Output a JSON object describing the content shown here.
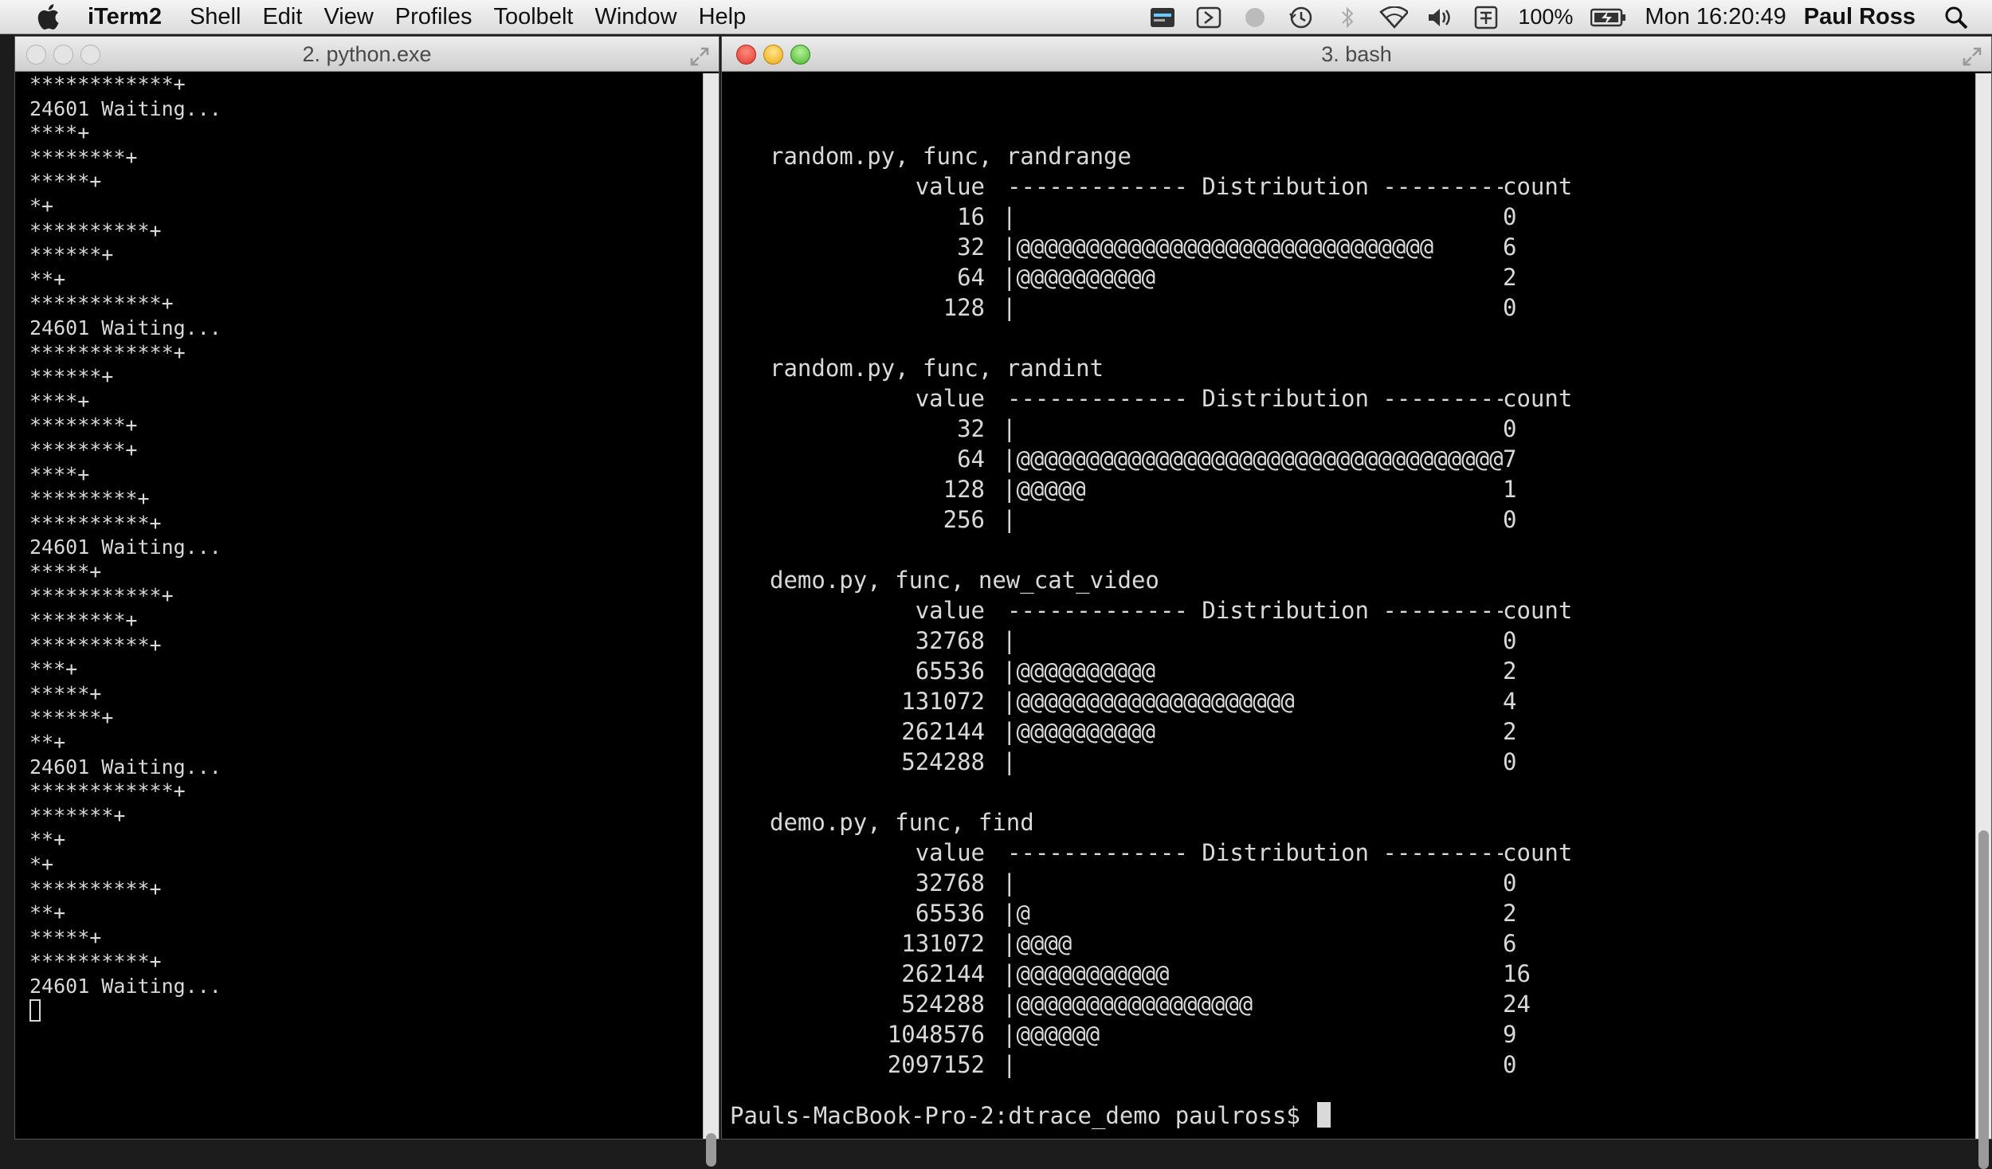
{
  "menubar": {
    "app_name": "iTerm2",
    "menus": [
      "Shell",
      "Edit",
      "View",
      "Profiles",
      "Toolbelt",
      "Window",
      "Help"
    ],
    "battery": "100%",
    "clock": "Mon 16:20:49",
    "user": "Paul Ross"
  },
  "left_window": {
    "title": "2. python.exe",
    "lines": [
      "************+",
      "24601 Waiting...",
      "****+",
      "********+",
      "*****+",
      "*+",
      "**********+",
      "******+",
      "**+",
      "***********+",
      "24601 Waiting...",
      "************+",
      "******+",
      "****+",
      "********+",
      "********+",
      "****+",
      "*********+",
      "**********+",
      "24601 Waiting...",
      "*****+",
      "***********+",
      "********+",
      "**********+",
      "***+",
      "*****+",
      "******+",
      "**+",
      "24601 Waiting...",
      "************+",
      "*******+",
      "**+",
      "*+",
      "**********+",
      "**+",
      "*****+",
      "**********+",
      "24601 Waiting..."
    ]
  },
  "right_window": {
    "title": "3. bash",
    "header": {
      "value": "value",
      "distribution": "------------- Distribution -------------",
      "count": "count"
    },
    "sections": [
      {
        "title": "random.py, func, randrange",
        "rows": [
          {
            "value": "16",
            "bar": "|",
            "count": "0"
          },
          {
            "value": "32",
            "bar": "|@@@@@@@@@@@@@@@@@@@@@@@@@@@@@@",
            "count": "6"
          },
          {
            "value": "64",
            "bar": "|@@@@@@@@@@",
            "count": "2"
          },
          {
            "value": "128",
            "bar": "|",
            "count": "0"
          }
        ]
      },
      {
        "title": "random.py, func, randint",
        "rows": [
          {
            "value": "32",
            "bar": "|",
            "count": "0"
          },
          {
            "value": "64",
            "bar": "|@@@@@@@@@@@@@@@@@@@@@@@@@@@@@@@@@@@",
            "count": "7"
          },
          {
            "value": "128",
            "bar": "|@@@@@",
            "count": "1"
          },
          {
            "value": "256",
            "bar": "|",
            "count": "0"
          }
        ]
      },
      {
        "title": "demo.py, func, new_cat_video",
        "rows": [
          {
            "value": "32768",
            "bar": "|",
            "count": "0"
          },
          {
            "value": "65536",
            "bar": "|@@@@@@@@@@",
            "count": "2"
          },
          {
            "value": "131072",
            "bar": "|@@@@@@@@@@@@@@@@@@@@",
            "count": "4"
          },
          {
            "value": "262144",
            "bar": "|@@@@@@@@@@",
            "count": "2"
          },
          {
            "value": "524288",
            "bar": "|",
            "count": "0"
          }
        ]
      },
      {
        "title": "demo.py, func, find",
        "rows": [
          {
            "value": "32768",
            "bar": "|",
            "count": "0"
          },
          {
            "value": "65536",
            "bar": "|@",
            "count": "2"
          },
          {
            "value": "131072",
            "bar": "|@@@@",
            "count": "6"
          },
          {
            "value": "262144",
            "bar": "|@@@@@@@@@@@",
            "count": "16"
          },
          {
            "value": "524288",
            "bar": "|@@@@@@@@@@@@@@@@@",
            "count": "24"
          },
          {
            "value": "1048576",
            "bar": "|@@@@@@",
            "count": "9"
          },
          {
            "value": "2097152",
            "bar": "|",
            "count": "0"
          }
        ]
      }
    ],
    "prompt": "Pauls-MacBook-Pro-2:dtrace_demo paulross$"
  }
}
